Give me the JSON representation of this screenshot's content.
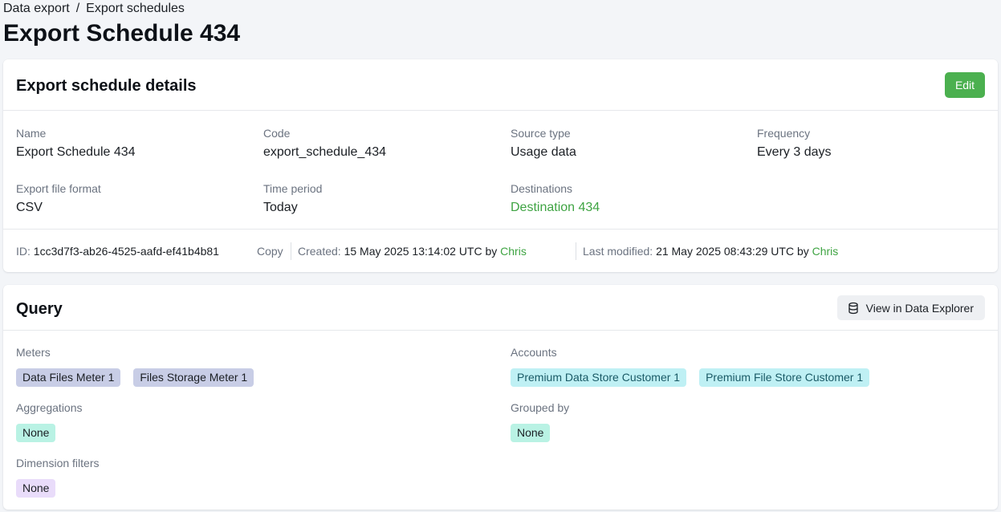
{
  "breadcrumb": {
    "items": [
      "Data export",
      "Export schedules"
    ],
    "separator": "/"
  },
  "page_title": "Export Schedule 434",
  "details": {
    "title": "Export schedule details",
    "edit_label": "Edit",
    "fields": {
      "name": {
        "label": "Name",
        "value": "Export Schedule 434"
      },
      "code": {
        "label": "Code",
        "value": "export_schedule_434"
      },
      "source_type": {
        "label": "Source type",
        "value": "Usage data"
      },
      "frequency": {
        "label": "Frequency",
        "value": "Every 3 days"
      },
      "file_format": {
        "label": "Export file format",
        "value": "CSV"
      },
      "time_period": {
        "label": "Time period",
        "value": "Today"
      },
      "destinations": {
        "label": "Destinations",
        "value": "Destination 434"
      }
    },
    "meta": {
      "id_label": "ID:",
      "id_value": "1cc3d7f3-ab26-4525-aafd-ef41b4b81",
      "copy_label": "Copy",
      "created_label": "Created:",
      "created_value": "15 May 2025 13:14:02 UTC by",
      "created_by": "Chris",
      "modified_label": "Last modified:",
      "modified_value": "21 May 2025 08:43:29 UTC by",
      "modified_by": "Chris"
    }
  },
  "query": {
    "title": "Query",
    "explorer_label": "View in Data Explorer",
    "explorer_icon": "database-icon",
    "meters": {
      "label": "Meters",
      "tags": [
        "Data Files Meter 1",
        "Files Storage Meter 1"
      ]
    },
    "accounts": {
      "label": "Accounts",
      "tags": [
        "Premium Data Store Customer 1",
        "Premium File Store Customer 1"
      ]
    },
    "aggregations": {
      "label": "Aggregations",
      "value": "None"
    },
    "grouped_by": {
      "label": "Grouped by",
      "value": "None"
    },
    "dimension_filters": {
      "label": "Dimension filters",
      "value": "None"
    }
  },
  "colors": {
    "accent_green": "#4bb04f",
    "link_green": "#3fa443",
    "meter_tag": "#c8cde6",
    "account_tag": "#bff0f4",
    "none_green_tag": "#b9f2e4",
    "none_purple_tag": "#e9dcfa"
  }
}
